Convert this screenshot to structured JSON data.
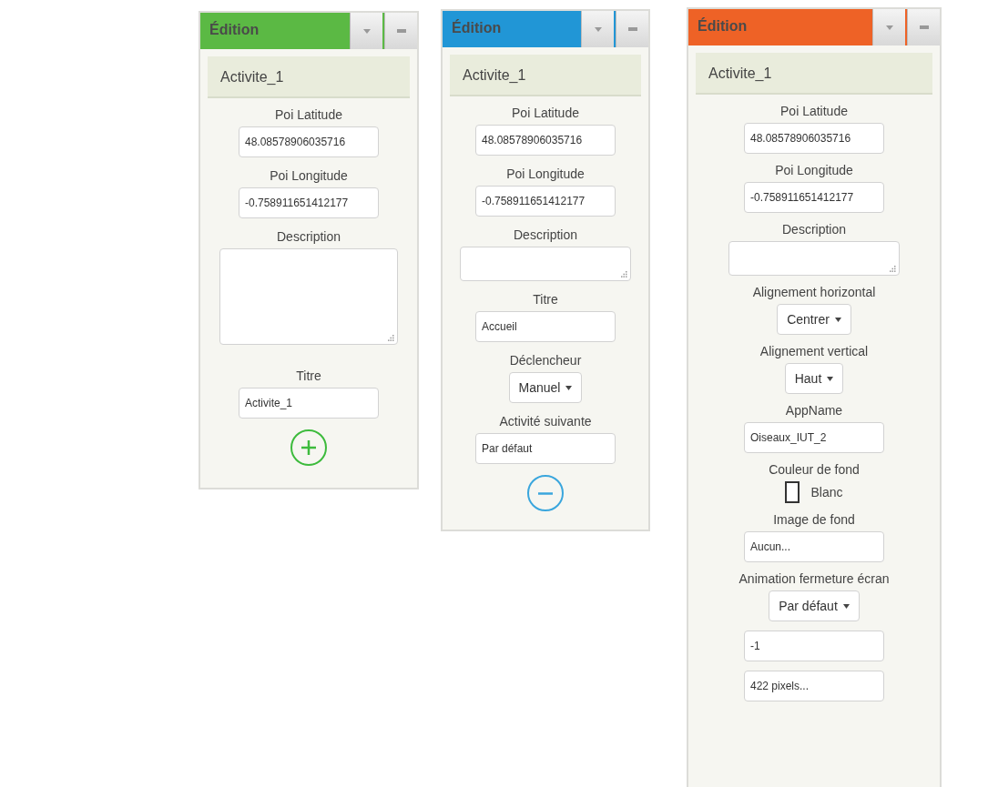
{
  "panels": [
    {
      "title": "Édition",
      "color": "#5bb944",
      "component": "Activite_1",
      "properties": [
        {
          "kind": "text",
          "label": "Poi Latitude",
          "value": "48.08578906035716"
        },
        {
          "kind": "text",
          "label": "Poi Longitude",
          "value": "-0.758911651412177"
        },
        {
          "kind": "textarea_large",
          "label": "Description"
        },
        {
          "kind": "text",
          "label": "Titre",
          "value": "Activite_1"
        },
        {
          "kind": "add_button",
          "color": "#3dbb3d"
        }
      ]
    },
    {
      "title": "Édition",
      "color": "#2196d6",
      "component": "Activite_1",
      "properties": [
        {
          "kind": "text",
          "label": "Poi Latitude",
          "value": "48.08578906035716"
        },
        {
          "kind": "text",
          "label": "Poi Longitude",
          "value": "-0.758911651412177"
        },
        {
          "kind": "textarea",
          "label": "Description"
        },
        {
          "kind": "text",
          "label": "Titre",
          "value": "Accueil"
        },
        {
          "kind": "select",
          "label": "Déclencheur",
          "value": "Manuel"
        },
        {
          "kind": "text",
          "label": "Activité suivante",
          "value": "Par défaut"
        },
        {
          "kind": "remove_button",
          "color": "#3aa6dd"
        }
      ]
    },
    {
      "title": "Édition",
      "color": "#ee6226",
      "component": "Activite_1",
      "properties": [
        {
          "kind": "text",
          "label": "Poi Latitude",
          "value": "48.08578906035716"
        },
        {
          "kind": "text",
          "label": "Poi Longitude",
          "value": "-0.758911651412177"
        },
        {
          "kind": "textarea",
          "label": "Description"
        },
        {
          "kind": "select",
          "label": "Alignement horizontal",
          "value": "Centrer"
        },
        {
          "kind": "select",
          "label": "Alignement vertical",
          "value": "Haut"
        },
        {
          "kind": "text",
          "label": "AppName",
          "value": "Oiseaux_IUT_2"
        },
        {
          "kind": "color",
          "label": "Couleur de fond",
          "value": "Blanc",
          "color": "#ffffff"
        },
        {
          "kind": "text",
          "label": "Image de fond",
          "value": "Aucun..."
        },
        {
          "kind": "select",
          "label": "Animation fermeture écran",
          "value": "Par défaut"
        },
        {
          "kind": "text",
          "value": "-1"
        },
        {
          "kind": "text",
          "value": "422 pixels..."
        }
      ]
    }
  ]
}
